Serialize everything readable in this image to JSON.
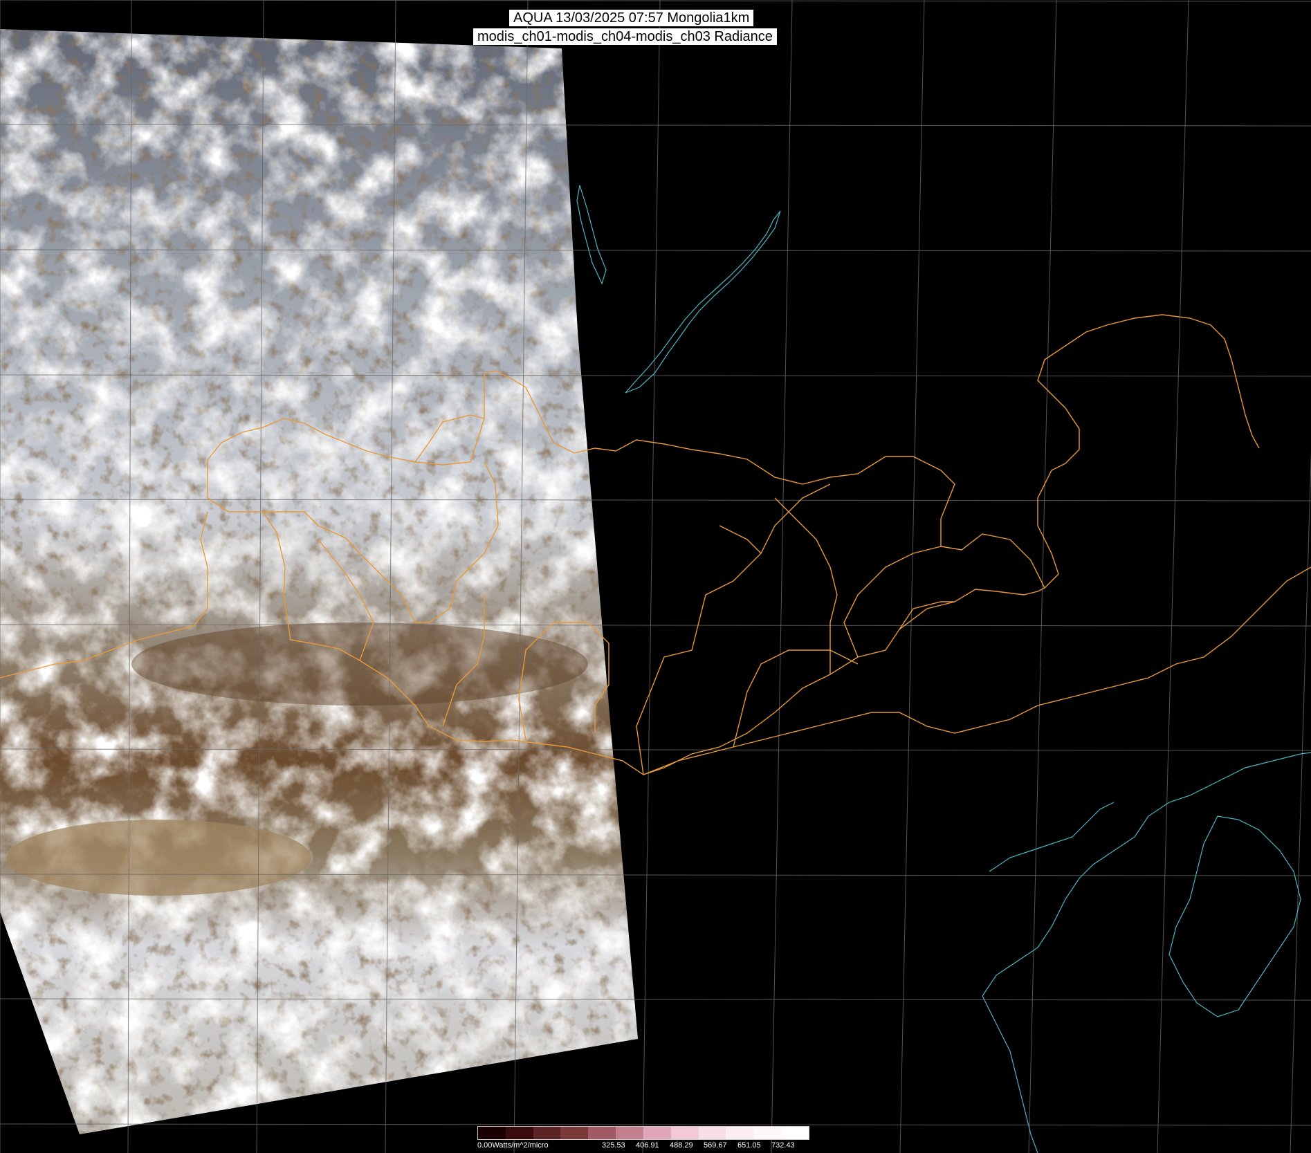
{
  "title": {
    "line1": "AQUA 13/03/2025 07:57 Mongolia1km",
    "line2": "modis_ch01-modis_ch04-modis_ch03 Radiance"
  },
  "colors": {
    "background": "#000000",
    "border_orange": "#e79a3a",
    "coast_cyan": "#4cb7c4",
    "graticule": "#6a6a6a",
    "snow": "#e9ecef",
    "desert": "#6e4a2d"
  },
  "colorbar": {
    "unit_label": "0.00Watts/m^2/micro",
    "ticks": [
      "325.53",
      "406.91",
      "488.29",
      "569.67",
      "651.05",
      "732.43"
    ],
    "colors": [
      "#1a0000",
      "#3a0d0d",
      "#5c2424",
      "#7a3a3a",
      "#a05a66",
      "#c47f8f",
      "#e0a7b8",
      "#f2c9d6",
      "#f7dee8",
      "#fbeef3",
      "#fdf7f9",
      "#ffffff"
    ]
  }
}
